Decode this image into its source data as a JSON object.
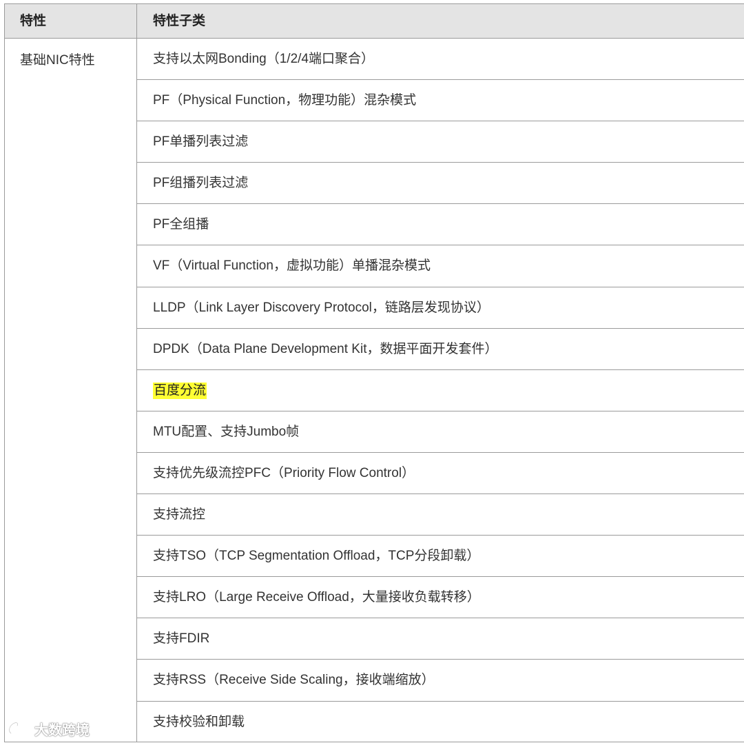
{
  "table": {
    "header": {
      "col1": "特性",
      "col2": "特性子类"
    },
    "category": "基础NIC特性",
    "rows": [
      {
        "text": "支持以太网Bonding（1/2/4端口聚合）",
        "highlight": false
      },
      {
        "text": "PF（Physical Function，物理功能）混杂模式",
        "highlight": false
      },
      {
        "text": "PF单播列表过滤",
        "highlight": false
      },
      {
        "text": "PF组播列表过滤",
        "highlight": false
      },
      {
        "text": "PF全组播",
        "highlight": false
      },
      {
        "text": "VF（Virtual Function，虚拟功能）单播混杂模式",
        "highlight": false
      },
      {
        "text": "LLDP（Link Layer Discovery Protocol，链路层发现协议）",
        "highlight": false
      },
      {
        "text": "DPDK（Data Plane Development Kit，数据平面开发套件）",
        "highlight": false
      },
      {
        "text": "百度分流",
        "highlight": true
      },
      {
        "text": "MTU配置、支持Jumbo帧",
        "highlight": false
      },
      {
        "text": "支持优先级流控PFC（Priority Flow Control）",
        "highlight": false
      },
      {
        "text": "支持流控",
        "highlight": false
      },
      {
        "text": "支持TSO（TCP Segmentation Offload，TCP分段卸载）",
        "highlight": false
      },
      {
        "text": "支持LRO（Large Receive Offload，大量接收负载转移）",
        "highlight": false
      },
      {
        "text": "支持FDIR",
        "highlight": false
      },
      {
        "text": "支持RSS（Receive Side Scaling，接收端缩放）",
        "highlight": false
      },
      {
        "text": "支持校验和卸载",
        "highlight": false
      }
    ]
  },
  "watermark": {
    "icon": "weibo-logo-icon",
    "text": "大数跨境"
  },
  "colors": {
    "header_bg": "#e4e4e4",
    "border": "#9a9a9a",
    "highlight": "#ffff33",
    "text": "#333333"
  }
}
